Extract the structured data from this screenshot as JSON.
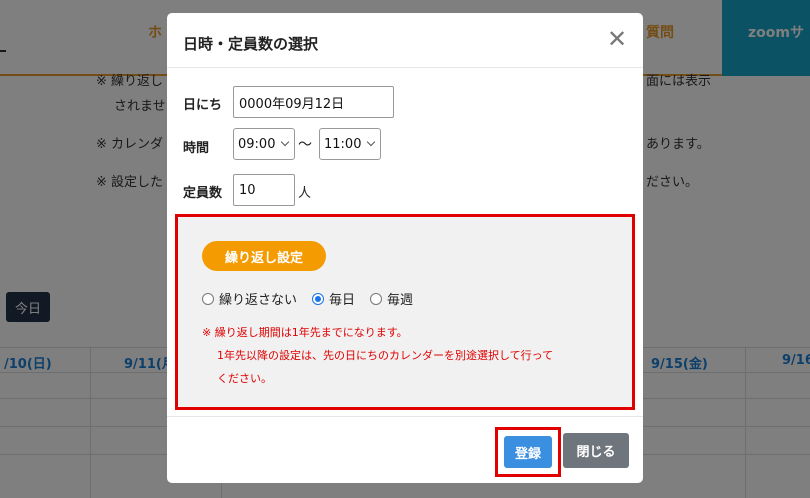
{
  "background": {
    "nav_left": "ホ",
    "nav_right": "質問",
    "nav_zoom": "zoomサ",
    "note1_line1": "※ 繰り返し",
    "note1_tail": "面には表示",
    "note1_line2": "されませ",
    "note2": "※ カレンダ",
    "note2_tail": "あります。",
    "note3": "※ 設定した",
    "note3_tail": "ださい。",
    "today_label": "今日",
    "calendar_days": [
      "/10(日)",
      "9/11(月",
      "9/15(金)",
      "9/16"
    ]
  },
  "modal": {
    "title": "日時・定員数の選択",
    "close_glyph": "✕",
    "date_label": "日にち",
    "date_value": "0000年09月12日",
    "time_label": "時間",
    "start_time": "09:00",
    "time_separator": "〜",
    "end_time": "11:00",
    "capacity_label": "定員数",
    "capacity_value": "10",
    "capacity_unit": "人",
    "repeat": {
      "badge": "繰り返し設定",
      "options": [
        "繰り返さない",
        "毎日",
        "毎週"
      ],
      "selected": "毎日",
      "note_line1": "※ 繰り返し期間は1年先までになります。",
      "note_line2": "1年先以降の設定は、先の日にちのカレンダーを別途選択して行って",
      "note_line3": "ください。"
    },
    "register_label": "登録",
    "close_label": "閉じる"
  },
  "colors": {
    "accent_orange": "#f39b00",
    "highlight_red": "#e00000",
    "primary_blue": "#3b8fe0",
    "zoom_blue": "#17a5c9"
  }
}
